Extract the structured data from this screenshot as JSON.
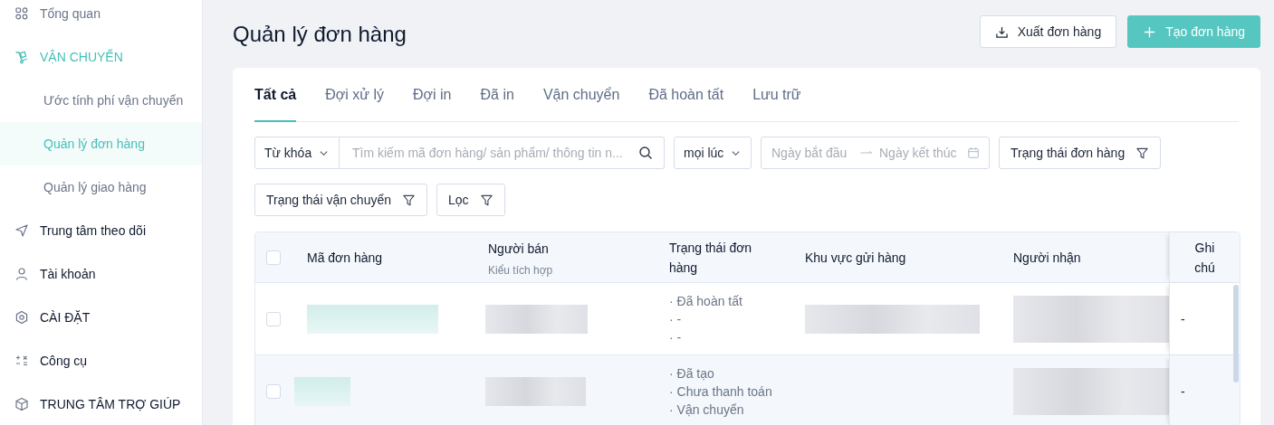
{
  "sidebar": {
    "items": [
      {
        "label": "Tổng quan",
        "expanded": false
      },
      {
        "label": "VẬN CHUYỂN",
        "expanded": true,
        "children": [
          {
            "label": "Ước tính phí vận chuyển",
            "selected": false
          },
          {
            "label": "Quản lý đơn hàng",
            "selected": true
          },
          {
            "label": "Quản lý giao hàng",
            "selected": false
          }
        ]
      },
      {
        "label": "Trung tâm theo dõi",
        "expanded": false
      },
      {
        "label": "Tài khoản",
        "expanded": false
      },
      {
        "label": "CÀI ĐẶT",
        "expanded": false
      },
      {
        "label": "Công cụ",
        "expanded": false
      },
      {
        "label": "TRUNG TÂM TRỢ GIÚP",
        "expanded": false
      }
    ]
  },
  "page": {
    "title": "Quản lý đơn hàng",
    "buttons": [
      {
        "label": "Xuất đơn hàng",
        "kind": "export"
      },
      {
        "label": "Tạo đơn hàng",
        "kind": "create"
      }
    ]
  },
  "tabs": [
    {
      "label": "Tất cả",
      "selected": true
    },
    {
      "label": "Đợi xử lý",
      "selected": false
    },
    {
      "label": "Đợi in",
      "selected": false
    },
    {
      "label": "Đã in",
      "selected": false
    },
    {
      "label": "Vận chuyển",
      "selected": false
    },
    {
      "label": "Đã hoàn tất",
      "selected": false
    },
    {
      "label": "Lưu trữ",
      "selected": false
    }
  ],
  "filters": {
    "keyword_select": "Từ khóa",
    "search": {
      "placeholder": "Tìm kiếm mã đơn hàng/ sản phẩm/ thông tin n..."
    },
    "time_select": "mọi lúc",
    "date_range": {
      "start_placeholder": "Ngày bắt đầu",
      "end_placeholder": "Ngày kết thúc"
    },
    "filter_buttons": [
      "Trạng thái đơn hàng",
      "Trạng thái vận chuyển",
      "Lọc"
    ]
  },
  "table": {
    "select_all": {
      "checked": false
    },
    "columns": [
      {
        "label": "Mã đơn hàng"
      },
      {
        "label": "Người bán",
        "sublabel": "Kiểu tích hợp"
      },
      {
        "label": "Trạng thái đơn hàng"
      },
      {
        "label": "Khu vực gửi hàng"
      },
      {
        "label": "Người nhận"
      },
      {
        "label": "Ghi chú"
      }
    ],
    "rows": [
      {
        "checked": false,
        "status_lines": [
          "· Đã hoàn tất",
          "· -",
          "· -"
        ],
        "note": "-"
      },
      {
        "checked": false,
        "status_lines": [
          "· Đã tạo",
          "· Chưa thanh toán",
          "· Vận chuyển"
        ],
        "note": "-"
      }
    ]
  }
}
